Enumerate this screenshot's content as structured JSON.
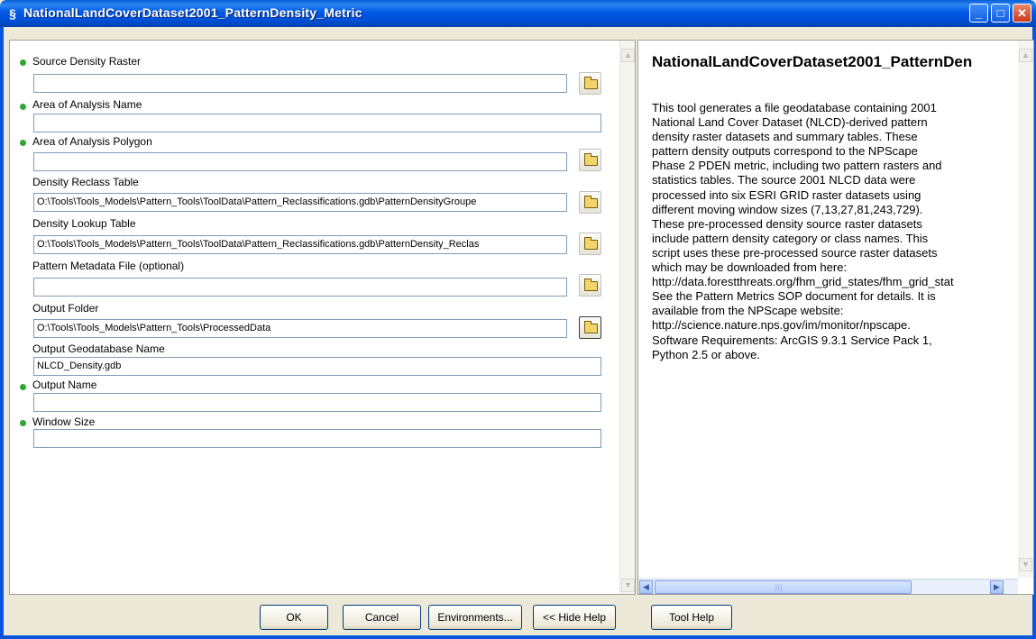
{
  "window": {
    "title": "NationalLandCoverDataset2001_PatternDensity_Metric",
    "controls": {
      "minimize": "_",
      "maximize": "□",
      "close": "✕"
    },
    "icon": "arcgis-tool-icon"
  },
  "params": [
    {
      "label": "Source Density Raster",
      "required": true,
      "value": "",
      "browse": true
    },
    {
      "label": "Area of Analysis Name",
      "required": true,
      "value": "",
      "browse": false
    },
    {
      "label": "Area of Analysis Polygon",
      "required": true,
      "value": "",
      "browse": true
    },
    {
      "label": "Density Reclass Table",
      "required": false,
      "value": "O:\\Tools\\Tools_Models\\Pattern_Tools\\ToolData\\Pattern_Reclassifications.gdb\\PatternDensityGroupe",
      "browse": true
    },
    {
      "label": "Density Lookup Table",
      "required": false,
      "value": "O:\\Tools\\Tools_Models\\Pattern_Tools\\ToolData\\Pattern_Reclassifications.gdb\\PatternDensity_Reclas",
      "browse": true
    },
    {
      "label": "Pattern Metadata File (optional)",
      "required": false,
      "value": "",
      "browse": true
    },
    {
      "label": "Output Folder",
      "required": false,
      "value": "O:\\Tools\\Tools_Models\\Pattern_Tools\\ProcessedData",
      "browse": true
    },
    {
      "label": "Output Geodatabase Name",
      "required": false,
      "value": "NLCD_Density.gdb",
      "browse": false
    },
    {
      "label": "Output Name",
      "required": true,
      "value": "",
      "browse": false
    },
    {
      "label": "Window Size",
      "required": true,
      "value": "",
      "browse": false
    }
  ],
  "help": {
    "title": "NationalLandCoverDataset2001_PatternDen",
    "lines": [
      "This tool generates a file geodatabase containing 2001",
      "National Land Cover Dataset (NLCD)-derived pattern",
      "density raster datasets and summary tables. These",
      "pattern density outputs correspond to the NPScape",
      "Phase 2 PDEN metric, including two pattern rasters and",
      "statistics tables. The source 2001 NLCD data were",
      "processed into six ESRI GRID raster datasets using",
      "different moving window sizes (7,13,27,81,243,729).",
      "These pre-processed density source raster datasets",
      "include pattern density category or class names. This",
      "script uses these pre-processed source raster datasets",
      "which may be downloaded from here:",
      "http://data.forestthreats.org/fhm_grid_states/fhm_grid_stat",
      "See the Pattern Metrics SOP document for details. It is",
      "available from the NPScape website:",
      "http://science.nature.nps.gov/im/monitor/npscape.",
      "Software Requirements: ArcGIS 9.3.1 Service Pack 1,",
      "Python 2.5 or above."
    ]
  },
  "buttons": {
    "ok": "OK",
    "cancel": "Cancel",
    "environments": "Environments...",
    "hide_help": "<< Hide Help",
    "tool_help": "Tool Help"
  },
  "scroll": {
    "up": "▲",
    "down": "▼",
    "left": "◀",
    "right": "▶"
  },
  "colors": {
    "titlebar": "#0058e6",
    "required_dot": "#2ea82e",
    "face": "#ece9d8"
  }
}
